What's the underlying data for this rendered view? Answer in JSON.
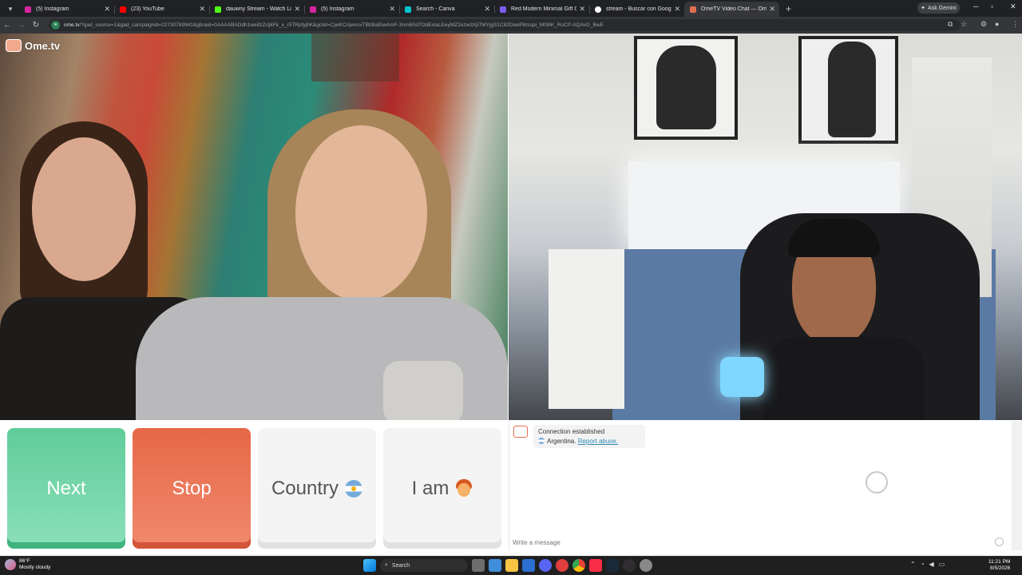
{
  "browser": {
    "tabs": [
      {
        "title": "(5) Instagram",
        "favicon_color": "#d6249f",
        "active": false
      },
      {
        "title": "(23) YouTube",
        "favicon_color": "#ff0000",
        "active": false
      },
      {
        "title": "dauwny Stream - Watch Live o",
        "favicon_color": "#53fc18",
        "active": false
      },
      {
        "title": "(5) Instagram",
        "favicon_color": "#d6249f",
        "active": false
      },
      {
        "title": "Search - Canva",
        "favicon_color": "#00c4cc",
        "active": false
      },
      {
        "title": "Red Modern Minimal Gift Guid",
        "favicon_color": "#7d5cf0",
        "active": false
      },
      {
        "title": "stream - Buscar con Google",
        "favicon_color": "#ffffff",
        "active": false
      },
      {
        "title": "OmeTV Video Chat — Ome",
        "favicon_color": "#e36e4f",
        "active": true
      }
    ],
    "new_tab_label": "+",
    "gemini_label": "Ask Gemini",
    "url_host": "ome.tv",
    "url_rest": "/?gad_source=1&gad_campaignid=22730789941&gbraid=0AAAABADdh1we8zZcljkFk_x_r5TRpfyjhK&gclid=CjwKCAjwvsvTBhBaEiwAmF-3nm6Sd7OdExlaLEeyMZ2ezw3XjiTMYjgS1C82DawPktsupi_M09iK_RoCP-AQAvD_BwE"
  },
  "app": {
    "logo_text": "Ome.tv",
    "buttons": {
      "next": "Next",
      "stop": "Stop",
      "country": "Country",
      "iam": "I am"
    },
    "chat": {
      "status": "Connection established",
      "country": "Argentina.",
      "report_link": "Report abuse.",
      "input_placeholder": "Write a message"
    }
  },
  "taskbar": {
    "weather_temp": "86°F",
    "weather_desc": "Mostly cloudy",
    "search_label": "Search",
    "time": "11:21 PM",
    "date": "8/5/2026"
  }
}
